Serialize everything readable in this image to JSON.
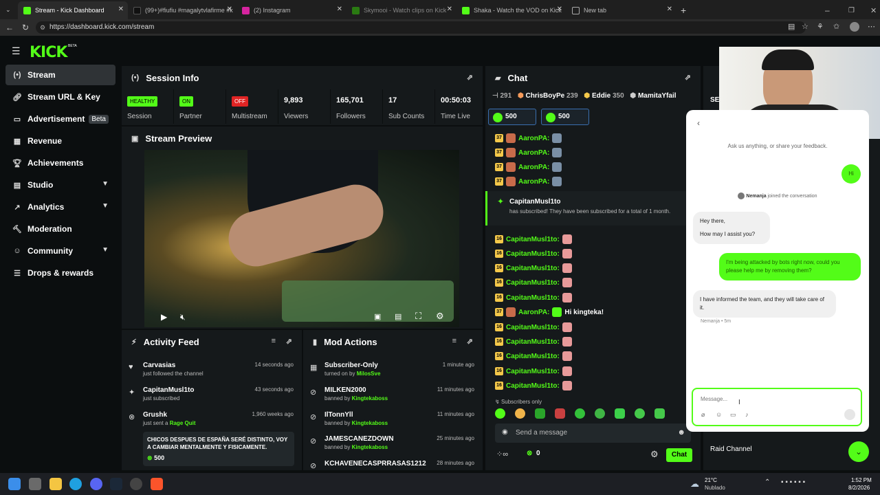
{
  "browser": {
    "tabs": [
      {
        "label": "Stream - Kick Dashboard",
        "color": "#53fc18"
      },
      {
        "label": "(99+)#fiufiu #magalytvlafirme #k",
        "color": "#111"
      },
      {
        "label": "(2) Instagram",
        "color": "#d6249f"
      },
      {
        "label": "Skymooi - Watch clips on Kick",
        "color": "#53fc18"
      },
      {
        "label": "Shaka - Watch the VOD on Kick",
        "color": "#53fc18"
      },
      {
        "label": "New tab",
        "color": "#888"
      }
    ],
    "url": "https://dashboard.kick.com/stream"
  },
  "sidebar": {
    "logo": "KICK",
    "logo_badge": "BETA",
    "items": [
      {
        "label": "Stream",
        "icon": "stream-icon"
      },
      {
        "label": "Stream URL & Key",
        "icon": "link-icon"
      },
      {
        "label": "Advertisement",
        "icon": "ad-icon",
        "badge": "Beta"
      },
      {
        "label": "Revenue",
        "icon": "revenue-icon"
      },
      {
        "label": "Achievements",
        "icon": "trophy-icon"
      },
      {
        "label": "Studio",
        "icon": "studio-icon"
      },
      {
        "label": "Analytics",
        "icon": "analytics-icon"
      },
      {
        "label": "Moderation",
        "icon": "moderation-icon"
      },
      {
        "label": "Community",
        "icon": "community-icon"
      },
      {
        "label": "Drops & rewards",
        "icon": "drops-icon"
      }
    ]
  },
  "session": {
    "title": "Session Info",
    "stats": [
      {
        "value": "HEALTHY",
        "label": "Session"
      },
      {
        "value": "ON",
        "label": "Partner"
      },
      {
        "value": "OFF",
        "label": "Multistream"
      },
      {
        "value": "9,893",
        "label": "Viewers"
      },
      {
        "value": "165,701",
        "label": "Followers"
      },
      {
        "value": "17",
        "label": "Sub Counts"
      },
      {
        "value": "00:50:03",
        "label": "Time Live"
      }
    ]
  },
  "preview": {
    "title": "Stream Preview"
  },
  "activity": {
    "title": "Activity Feed",
    "items": [
      {
        "name": "Carvasias",
        "sub": "just followed the channel",
        "time": "14 seconds ago"
      },
      {
        "name": "CapitanMusl1to",
        "sub": "just subscribed",
        "time": "43 seconds ago"
      },
      {
        "name": "Grushk",
        "sub": "just sent a",
        "sub_link": "Rage Quit",
        "time": "1,960 weeks ago"
      }
    ],
    "message": "CHICOS DESPUES DE ESPAÑA SERÉ DISTINTO, VOY A CAMBIAR MENTALMENTE Y FISICAMENTE.",
    "kicks": "500"
  },
  "mod": {
    "title": "Mod Actions",
    "items": [
      {
        "name": "Subscriber-Only",
        "sub": "turned on by",
        "by": "MilosSve",
        "time": "1 minute ago"
      },
      {
        "name": "MILKEN2000",
        "sub": "banned by",
        "by": "Kingtekaboss",
        "time": "11 minutes ago"
      },
      {
        "name": "IlTonnYll",
        "sub": "banned by",
        "by": "Kingtekaboss",
        "time": "11 minutes ago"
      },
      {
        "name": "JAMESCANEZDOWN",
        "sub": "banned by",
        "by": "Kingtekaboss",
        "time": "25 minutes ago"
      },
      {
        "name": "KCHAVENECASPRRASAS1212",
        "sub": "",
        "by": "",
        "time": "28 minutes ago"
      }
    ]
  },
  "chat": {
    "title": "Chat",
    "leaders": [
      {
        "name": "",
        "score": "291"
      },
      {
        "name": "ChrisBoyPe",
        "score": "239"
      },
      {
        "name": "Eddie",
        "score": "350"
      },
      {
        "name": "MamitaYfail",
        "score": ""
      }
    ],
    "pinned": [
      "500",
      "500"
    ],
    "sub_user": "CapitanMusl1to",
    "sub_text": "has subscribed! They have been subscribed for a total of 1 month.",
    "lines": [
      {
        "badge": "37",
        "user": "AaronPA:",
        "text": ""
      },
      {
        "badge": "37",
        "user": "AaronPA:",
        "text": ""
      },
      {
        "badge": "37",
        "user": "AaronPA:",
        "text": ""
      },
      {
        "badge": "37",
        "user": "AaronPA:",
        "text": ""
      },
      {
        "badge": "16",
        "user": "CapitanMusl1to:",
        "text": ""
      },
      {
        "badge": "16",
        "user": "CapitanMusl1to:",
        "text": ""
      },
      {
        "badge": "16",
        "user": "CapitanMusl1to:",
        "text": ""
      },
      {
        "badge": "16",
        "user": "CapitanMusl1to:",
        "text": ""
      },
      {
        "badge": "16",
        "user": "CapitanMusl1to:",
        "text": ""
      },
      {
        "badge": "37",
        "user": "AaronPA:",
        "text": "Hi kingteka!"
      },
      {
        "badge": "16",
        "user": "CapitanMusl1to:",
        "text": ""
      },
      {
        "badge": "16",
        "user": "CapitanMusl1to:",
        "text": ""
      },
      {
        "badge": "16",
        "user": "CapitanMusl1to:",
        "text": ""
      },
      {
        "badge": "16",
        "user": "CapitanMusl1to:",
        "text": ""
      },
      {
        "badge": "16",
        "user": "CapitanMusl1to:",
        "text": ""
      }
    ],
    "subs_only": "Subscribers only",
    "placeholder": "Send a message",
    "kicks": "0",
    "send": "Chat"
  },
  "right": {
    "tab": "SE",
    "raid": "Raid Channel"
  },
  "support": {
    "intro": "Ask us anything, or share your feedback.",
    "user1": "Hi",
    "agent_joined_name": "Nemanja",
    "agent_joined_text": "joined the conversation",
    "agent1a": "Hey there,",
    "agent1b": "How may I assist you?",
    "user2": "I'm being attacked by bots right now, could you please help me by removing them?",
    "agent2": "I have informed the team, and they will take care of it.",
    "meta": "Nemanja • 5m",
    "placeholder": "Message..."
  },
  "taskbar": {
    "temp": "21°C",
    "weather": "Nublado",
    "time": "1:52 PM",
    "date": "8/2/2026"
  }
}
